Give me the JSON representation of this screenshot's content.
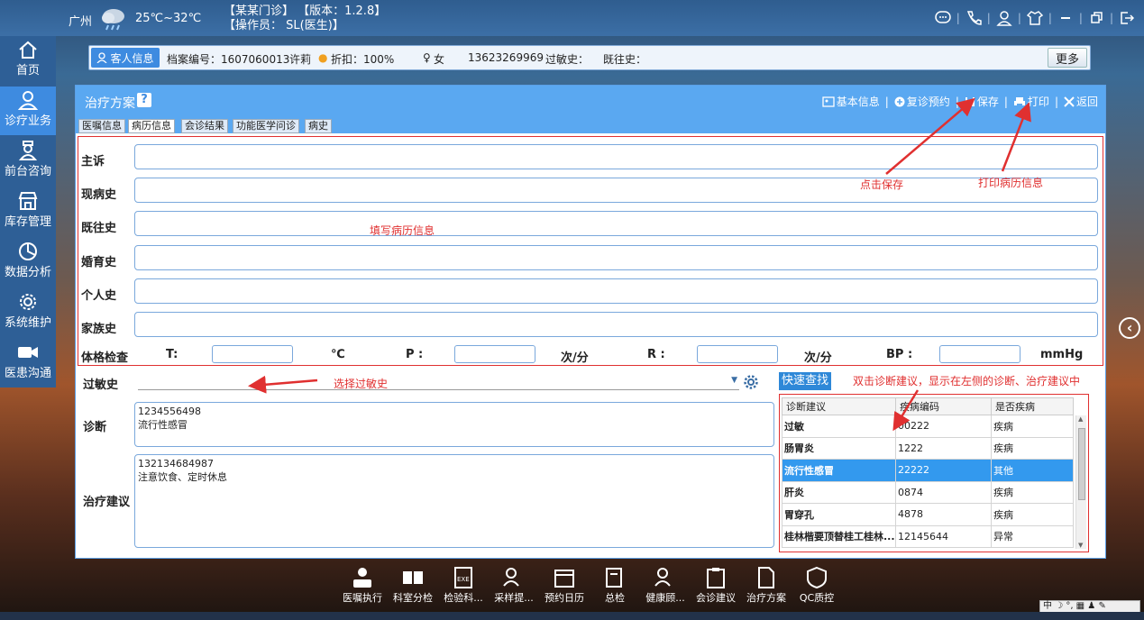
{
  "topbar": {
    "city": "广州",
    "temp": "25℃~32℃",
    "clinic_line": "【某某门诊】 【版本：1.2.8】",
    "operator_line": "【操作员： SL(医生)】"
  },
  "sidebar": {
    "items": [
      {
        "label": "首页",
        "icon": "home-icon"
      },
      {
        "label": "诊疗业务",
        "icon": "doctor-icon"
      },
      {
        "label": "前台咨询",
        "icon": "nurse-icon"
      },
      {
        "label": "库存管理",
        "icon": "store-icon"
      },
      {
        "label": "数据分析",
        "icon": "pie-icon"
      },
      {
        "label": "系统维护",
        "icon": "gear-icon"
      },
      {
        "label": "医患沟通",
        "icon": "video-icon"
      }
    ]
  },
  "patient": {
    "tag": "客人信息",
    "record_no": "档案编号：1607060013",
    "name": "许莉",
    "discount": "折扣：100%",
    "gender": "女",
    "phone": "13623269969",
    "allergy_label": "过敏史：",
    "past_label": "既往史：",
    "more": "更多"
  },
  "panel": {
    "title": "治疗方案",
    "help": "?",
    "actions": {
      "basic": "基本信息",
      "revisit": "复诊预约",
      "save": "保存",
      "print": "打印",
      "back": "返回"
    },
    "tabs": [
      "医嘱信息",
      "病历信息",
      "会诊结果",
      "功能医学问诊",
      "病史"
    ]
  },
  "form": {
    "fields": [
      "主诉",
      "现病史",
      "既往史",
      "婚育史",
      "个人史",
      "家族史"
    ],
    "vitals": {
      "label": "体格检查",
      "t": "T:",
      "t_unit": "℃",
      "p": "P :",
      "p_unit": "次/分",
      "r": "R :",
      "r_unit": "次/分",
      "bp": "BP :",
      "bp_unit": "mmHg"
    },
    "allergy_label": "过敏史",
    "diagnosis_label": "诊断",
    "diagnosis_value": "1234556498\n流行性感冒",
    "advice_label": "治疗建议",
    "advice_value": "132134684987\n注意饮食、定时休息"
  },
  "quick": {
    "button": "快速查找",
    "columns": [
      "诊断建议",
      "疾病编码",
      "是否疾病"
    ],
    "rows": [
      [
        "过敏",
        "00222",
        "疾病"
      ],
      [
        "肠胃炎",
        "1222",
        "疾病"
      ],
      [
        "流行性感冒",
        "22222",
        "其他"
      ],
      [
        "肝炎",
        "0874",
        "疾病"
      ],
      [
        "胃穿孔",
        "4878",
        "疾病"
      ],
      [
        "桂林楷要顶替桂工桂林...",
        "12145644",
        "异常"
      ]
    ]
  },
  "annotations": {
    "save": "点击保存",
    "print": "打印病历信息",
    "fill": "填写病历信息",
    "allergy": "选择过敏史",
    "dblclick": "双击诊断建议，显示在左侧的诊断、治疗建议中"
  },
  "dock": [
    "医嘱执行",
    "科室分检",
    "检验科...",
    "采样提...",
    "预约日历",
    "总检",
    "健康顾...",
    "会诊建议",
    "治疗方案",
    "QC质控"
  ],
  "ime": "中 ☽ °, ▦ ♟ ✎",
  "colors": {
    "primary": "#3e8be0",
    "header": "#5aa8f1",
    "sidebar": "#2e5f96",
    "annotation": "#e03030",
    "selected_row": "#3399ee"
  }
}
